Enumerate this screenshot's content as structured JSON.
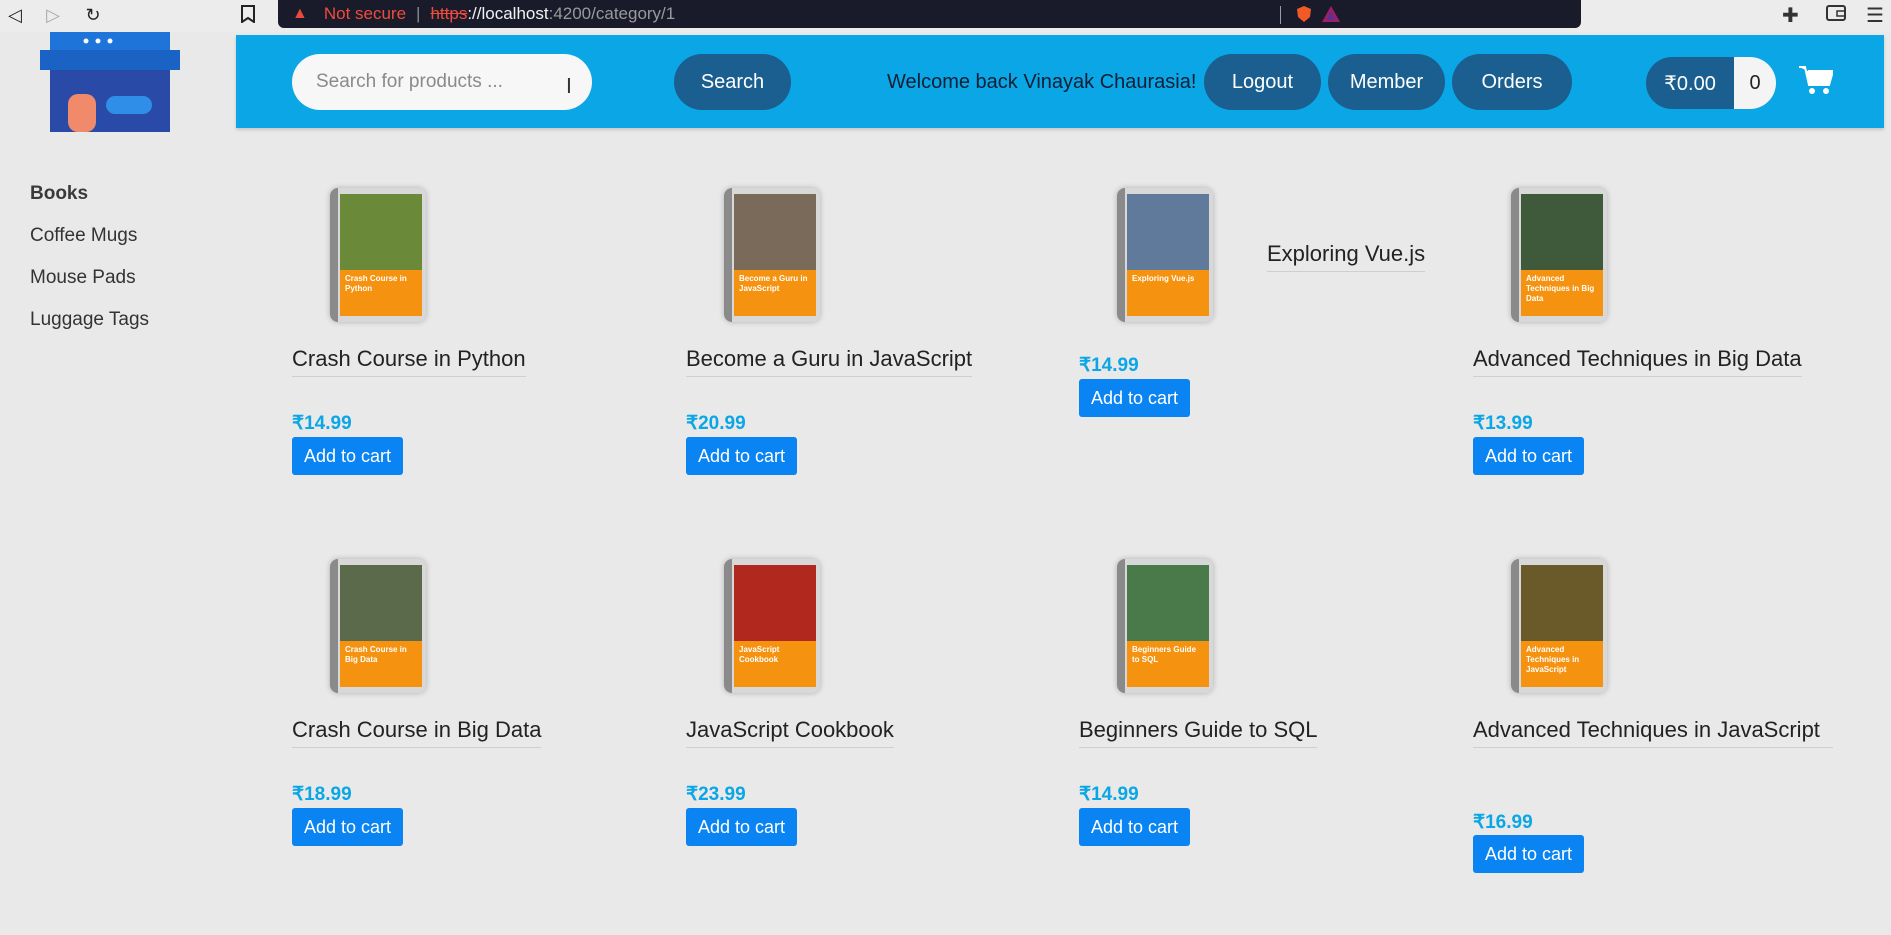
{
  "browser": {
    "security_label": "Not secure",
    "url_scheme": "https",
    "url_host": "://localhost",
    "url_path": ":4200/category/1"
  },
  "header": {
    "search_placeholder": "Search for products ...",
    "search_label": "Search",
    "welcome": "Welcome back Vinayak Chaurasia!",
    "logout_label": "Logout",
    "member_label": "Member",
    "orders_label": "Orders",
    "cart_total": "₹0.00",
    "cart_count": "0"
  },
  "sidebar": {
    "items": [
      {
        "label": "Books"
      },
      {
        "label": "Coffee Mugs"
      },
      {
        "label": "Mouse Pads"
      },
      {
        "label": "Luggage Tags"
      }
    ]
  },
  "products": [
    {
      "title": "Crash Course in Python",
      "cover_title": "Crash Course in Python",
      "price": "₹14.99",
      "button": "Add to cart",
      "photo": "#6a8a3a"
    },
    {
      "title": "Become a Guru in JavaScript",
      "cover_title": "Become a Guru in JavaScript",
      "price": "₹20.99",
      "button": "Add to cart",
      "photo": "#7a6a5a"
    },
    {
      "title": "Exploring Vue.js",
      "cover_title": "Exploring Vue.js",
      "price": "₹14.99",
      "button": "Add to cart",
      "photo": "#5f7a9a"
    },
    {
      "title": "Advanced Techniques in Big Data",
      "cover_title": "Advanced Techniques in Big Data",
      "price": "₹13.99",
      "button": "Add to cart",
      "photo": "#3f5a3a"
    },
    {
      "title": "Crash Course in Big Data",
      "cover_title": "Crash Course in Big Data",
      "price": "₹18.99",
      "button": "Add to cart",
      "photo": "#5a6a4a"
    },
    {
      "title": "JavaScript Cookbook",
      "cover_title": "JavaScript Cookbook",
      "price": "₹23.99",
      "button": "Add to cart",
      "photo": "#b0281e"
    },
    {
      "title": "Beginners Guide to SQL",
      "cover_title": "Beginners Guide to SQL",
      "price": "₹14.99",
      "button": "Add to cart",
      "photo": "#4a7a4a"
    },
    {
      "title": "Advanced Techniques in JavaScript",
      "cover_title": "Advanced Techniques in JavaScript",
      "price": "₹16.99",
      "button": "Add to cart",
      "photo": "#6a5a2a"
    }
  ]
}
